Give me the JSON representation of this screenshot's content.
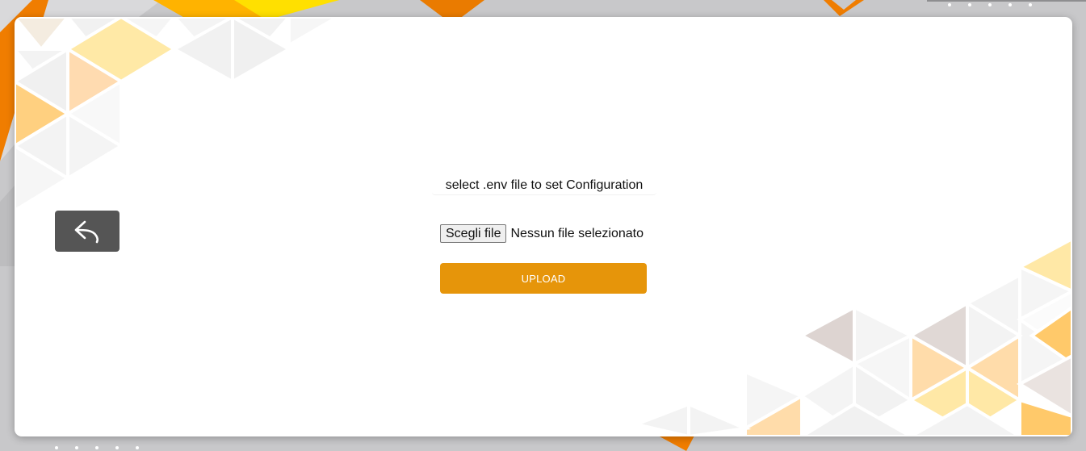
{
  "back": {
    "icon": "reply-arrow-icon"
  },
  "upload_form": {
    "title": "select .env file to set Configuration",
    "file_button_label": "Scegli file",
    "file_status": "Nessun file selezionato",
    "submit_label": "UPLOAD"
  },
  "colors": {
    "accent": "#e6950a",
    "back_button": "#555555",
    "backdrop": "#c9c9cb",
    "orange": "#f08a00",
    "yellow": "#ffd400"
  }
}
